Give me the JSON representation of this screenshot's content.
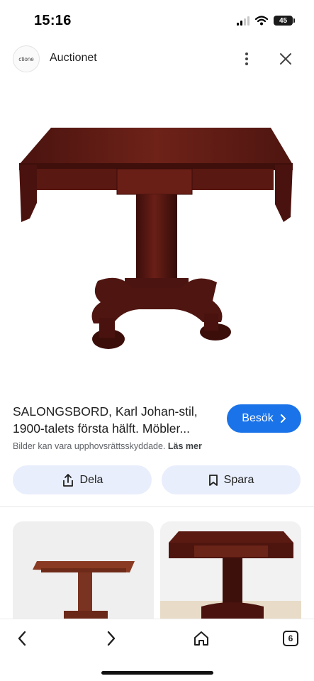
{
  "status_bar": {
    "time": "15:16",
    "battery": "45"
  },
  "header": {
    "site_avatar_text": "ctione",
    "site_name": "Auctionet"
  },
  "result": {
    "title": "SALONGSBORD, Karl Johan-stil, 1900-talets första hälft. Möbler...",
    "copyright_text": "Bilder kan vara upphovsrättsskyddade.",
    "read_more": "Läs mer",
    "visit_label": "Besök"
  },
  "actions": {
    "share_label": "Dela",
    "save_label": "Spara"
  },
  "bottom_nav": {
    "tab_count": "6"
  },
  "colors": {
    "accent": "#1a73e8",
    "action_bg": "#e8eefc",
    "table_wood": "#5a1812"
  }
}
